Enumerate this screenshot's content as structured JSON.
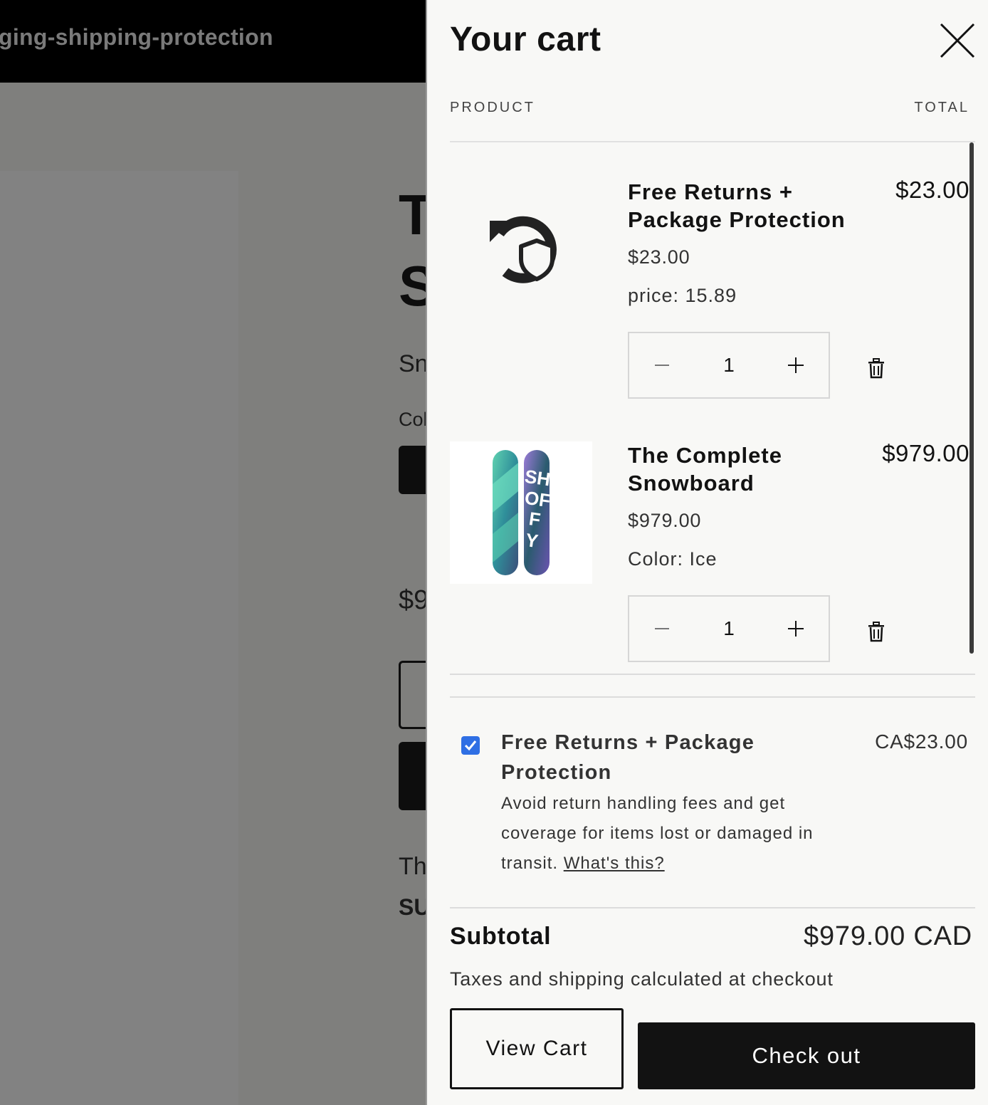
{
  "background": {
    "header_text": "ging-shipping-protection",
    "title_line1": "T",
    "title_line2": "S",
    "text_sn": "Sn",
    "text_col": "Col",
    "price_fragment": "$9",
    "text_th": "Th",
    "text_su": "SU"
  },
  "cart": {
    "title": "Your cart",
    "columns": {
      "product": "PRODUCT",
      "total": "TOTAL"
    },
    "items": [
      {
        "name": "Free Returns + Package Protection",
        "total": "$23.00",
        "price": "$23.00",
        "property": "price: 15.89",
        "quantity": "1",
        "image_icon": "returns-shield-icon"
      },
      {
        "name": "The Complete Snowboard",
        "total": "$979.00",
        "price": "$979.00",
        "property": "Color: Ice",
        "quantity": "1",
        "image_icon": "snowboard-image"
      }
    ],
    "protection": {
      "checked": true,
      "title": "Free Returns + Package Protection",
      "price": "CA$23.00",
      "description": "Avoid return handling fees and get coverage for items lost or damaged in transit.",
      "link": "What's this?"
    },
    "subtotal_label": "Subtotal",
    "subtotal_value": "$979.00 CAD",
    "tax_note": "Taxes and shipping calculated at checkout",
    "view_cart_label": "View Cart",
    "checkout_label": "Check out"
  },
  "colors": {
    "accent_checkbox": "#2f6fe4",
    "button_dark": "#121212",
    "drawer_bg": "#f8f8f6",
    "overlay": "#7f7f7d"
  }
}
